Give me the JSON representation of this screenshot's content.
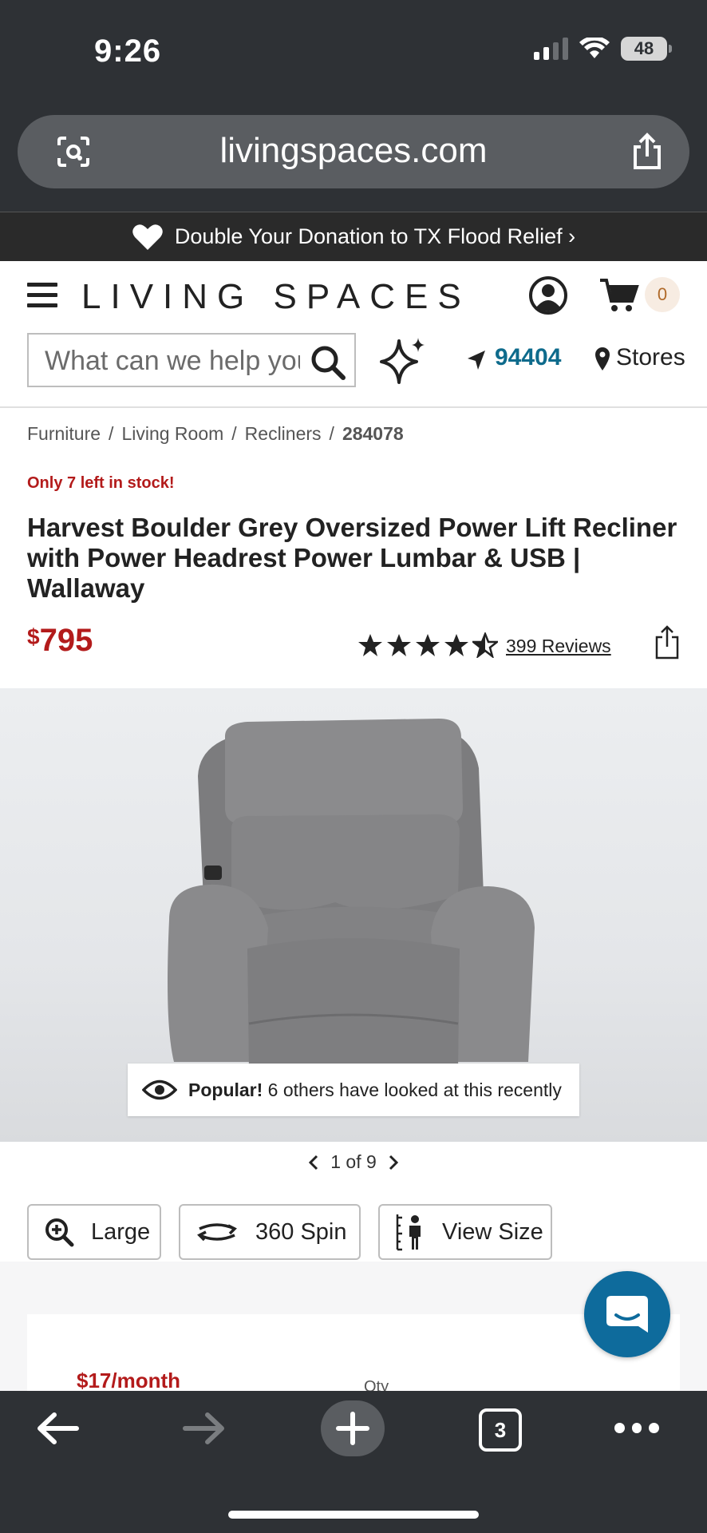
{
  "status_bar": {
    "time": "9:26",
    "battery": "48"
  },
  "browser": {
    "url": "livingspaces.com",
    "tab_count": "3"
  },
  "promo_banner": {
    "text": "Double Your Donation to TX Flood Relief ›"
  },
  "header": {
    "logo": "LIVING SPACES",
    "cart_count": "0",
    "search_placeholder": "What can we help you find?",
    "zip": "94404",
    "stores_label": "Stores"
  },
  "breadcrumb": [
    "Furniture",
    "Living Room",
    "Recliners",
    "284078"
  ],
  "product": {
    "stock_notice": "Only 7 left in stock!",
    "title": "Harvest Boulder Grey Oversized Power Lift Recliner with Power Headrest Power Lumbar & USB | Wallaway",
    "price_currency": "$",
    "price_amount": "795",
    "rating": 4.5,
    "reviews_label": "399 Reviews"
  },
  "gallery": {
    "popular_bold": "Popular!",
    "popular_text": "6 others have looked at this recently",
    "pager": "1 of 9",
    "buttons": {
      "large": "Large",
      "spin": "360 Spin",
      "size": "View Size"
    }
  },
  "purchase": {
    "monthly": "$17/month",
    "qty_label": "Qty"
  },
  "colors": {
    "brand_red": "#b31b1b",
    "link_blue": "#0e6b8c",
    "chat_blue": "#0e6b9c",
    "chrome_dark": "#2e3135"
  }
}
